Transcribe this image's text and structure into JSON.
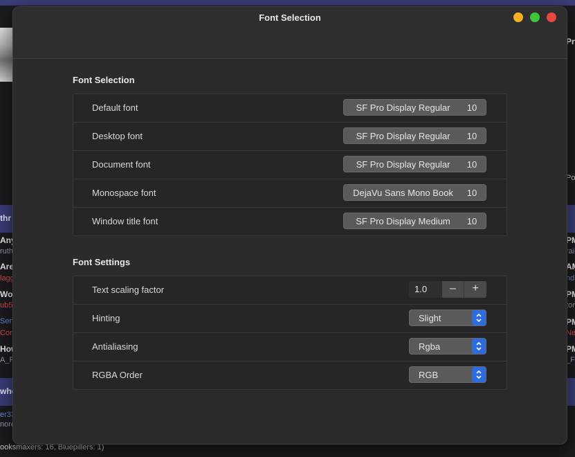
{
  "window": {
    "title": "Font Selection"
  },
  "font_selection": {
    "heading": "Font Selection",
    "rows": [
      {
        "label": "Default font",
        "font": "SF Pro Display Regular",
        "size": "10"
      },
      {
        "label": "Desktop font",
        "font": "SF Pro Display Regular",
        "size": "10"
      },
      {
        "label": "Document font",
        "font": "SF Pro Display Regular",
        "size": "10"
      },
      {
        "label": "Monospace font",
        "font": "DejaVu Sans Mono Book",
        "size": "10"
      },
      {
        "label": "Window title font",
        "font": "SF Pro Display Medium",
        "size": "10"
      }
    ]
  },
  "font_settings": {
    "heading": "Font Settings",
    "scaling": {
      "label": "Text scaling factor",
      "value": "1.0",
      "minus": "–",
      "plus": "+"
    },
    "hinting": {
      "label": "Hinting",
      "value": "Slight"
    },
    "antialiasing": {
      "label": "Antialiasing",
      "value": "Rgba"
    },
    "rgba_order": {
      "label": "RGBA Order",
      "value": "RGB"
    }
  },
  "background": {
    "right_texts": [
      "Pre",
      "Pos",
      "PM",
      "rai",
      "AM",
      "ndr",
      "PM",
      "ton",
      "PM",
      "Ne",
      "PM",
      "_FM"
    ],
    "left_texts": [
      "thr",
      "Any",
      "ruthp",
      "Are",
      "lagg",
      "Wor",
      "ub5",
      "Sen",
      "Corin",
      "How",
      "A_F",
      "who",
      "er33",
      "nore"
    ],
    "footer": "ooksmaxers: 16, Bluepillers: 1)"
  },
  "colors": {
    "accent": "#2d6cdf",
    "close": "#e6473f",
    "minimize": "#f5b024",
    "maximize": "#3fc43a",
    "band": "#3b3f7a"
  }
}
